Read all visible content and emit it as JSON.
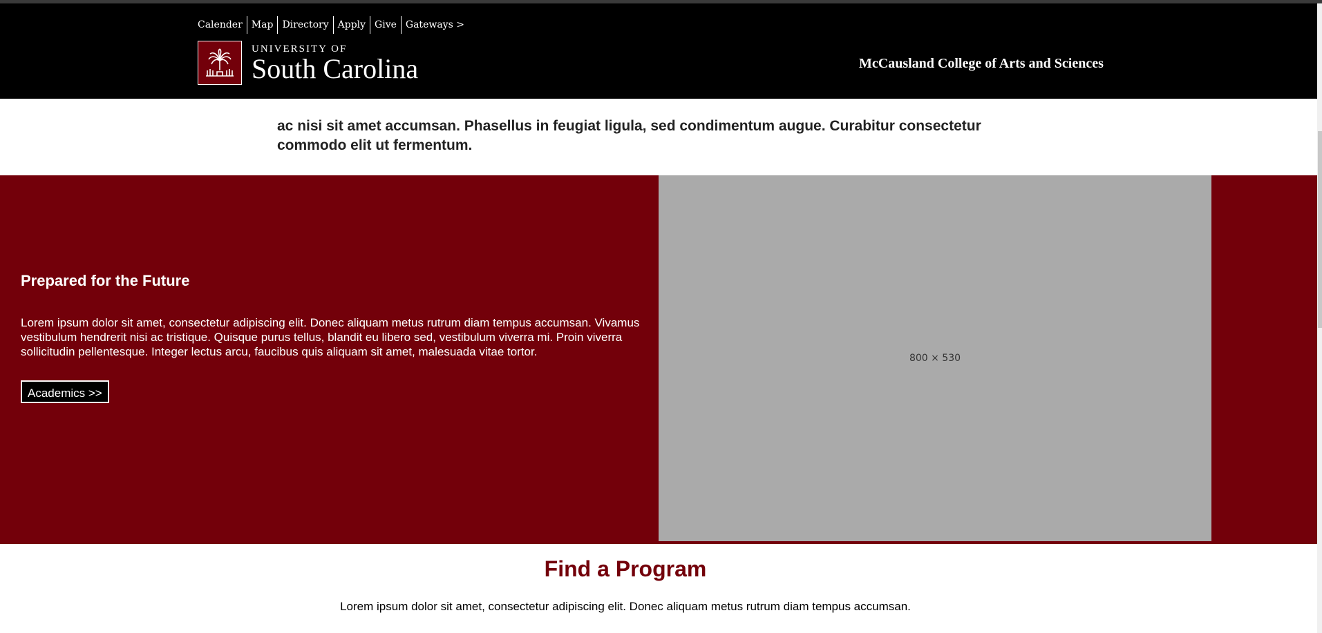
{
  "utility_nav": [
    "Calender",
    "Map",
    "Directory",
    "Apply",
    "Give",
    "Gateways >"
  ],
  "logo": {
    "line1": "UNIVERSITY OF",
    "line2": "South Carolina"
  },
  "college_name": "McCausland College of Arts and Sciences",
  "intro_text": "ac nisi sit amet accumsan. Phasellus in feugiat ligula, sed condimentum augue. Curabitur consectetur commodo elit ut fermentum.",
  "feature": {
    "title": "Prepared for the Future",
    "body": "Lorem ipsum dolor sit amet, consectetur adipiscing elit. Donec aliquam metus rutrum diam tempus accumsan. Vivamus vestibulum hendrerit nisi ac tristique. Quisque purus tellus, blandit eu libero sed, vestibulum viverra mi. Proin viverra sollicitudin pellentesque. Integer lectus arcu, faucibus quis aliquam sit amet, malesuada vitae tortor.",
    "button": "Academics >>",
    "image_placeholder": "800 × 530"
  },
  "find_program": {
    "title": "Find a Program",
    "body": "Lorem ipsum dolor sit amet, consectetur adipiscing elit. Donec aliquam metus rutrum diam tempus accumsan."
  },
  "colors": {
    "garnet": "#73000a",
    "header": "#000000",
    "placeholder": "#aaaaaa"
  },
  "icons": {
    "seal": "usc-palmetto-seal-icon"
  }
}
